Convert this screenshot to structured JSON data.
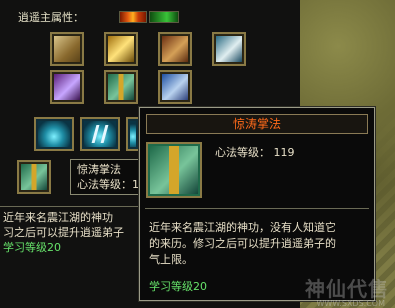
{
  "panel": {
    "attribute_label": "逍遥主属性：",
    "bars": [
      {
        "name": "fire-attribute-bar",
        "color": "#e25a10"
      },
      {
        "name": "green-attribute-bar",
        "color": "#39c338"
      }
    ],
    "scroll_icons": [
      "scroll-icon",
      "scroll-icon",
      "scroll-icon",
      "scroll-icon",
      "scroll-icon",
      "scroll-icon",
      "scroll-icon",
      "scroll-icon"
    ],
    "selected_skill": {
      "name_short": "惊涛掌法",
      "level_short": "心法等级：1"
    },
    "bottom_desc": {
      "line1": "近年来名震江湖的神功",
      "line2": "习之后可以提升逍遥弟子",
      "study_level": "学习等级20"
    }
  },
  "tooltip": {
    "title": "惊涛掌法",
    "level_text": "心法等级： 119",
    "desc_line1": "近年来名震江湖的神功，没有人知道它",
    "desc_line2": "的来历。修习之后可以提升逍遥弟子的",
    "desc_line3": "气上限。",
    "study_level": "学习等级20"
  },
  "watermark": {
    "text": "神仙代售",
    "url": "WWW.SXDS.COM"
  }
}
